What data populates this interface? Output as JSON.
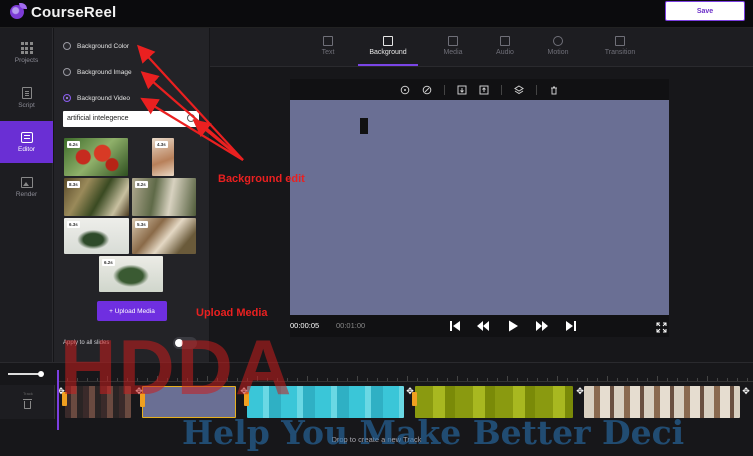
{
  "app": {
    "name": "CourseReel",
    "save_label": "Save"
  },
  "nav": [
    {
      "label": "Projects",
      "icon": "grid-icon"
    },
    {
      "label": "Script",
      "icon": "document-icon"
    },
    {
      "label": "Editor",
      "icon": "editor-icon",
      "active": true
    },
    {
      "label": "Render",
      "icon": "image-icon"
    }
  ],
  "panel": {
    "options": [
      {
        "label": "Background Color",
        "selected": false
      },
      {
        "label": "Background Image",
        "selected": false
      },
      {
        "label": "Background Video",
        "selected": true
      }
    ],
    "search_value": "artificial intelegence",
    "thumbs": [
      "6.2s",
      "4.3s",
      "8.3s",
      "8.2s",
      "6.3s",
      "5.3s",
      "6.2s"
    ],
    "upload_label": "+ Upload Media",
    "apply_label": "Apply to all slides",
    "apply_enabled": false
  },
  "tabs": [
    {
      "label": "Text",
      "icon": "text-icon"
    },
    {
      "label": "Background",
      "icon": "background-icon",
      "active": true
    },
    {
      "label": "Media",
      "icon": "media-icon"
    },
    {
      "label": "Audio",
      "icon": "audio-icon"
    },
    {
      "label": "Motion",
      "icon": "motion-icon"
    },
    {
      "label": "Transition",
      "icon": "transition-icon"
    }
  ],
  "player": {
    "current_time": "00:00:05",
    "total_time": "00:01:00"
  },
  "timeline": {
    "drop_text": "Drop to create a new Track",
    "track_label": "Track"
  },
  "annotations": {
    "background_edit": "Background edit",
    "upload_media": "Upload Media"
  },
  "watermark": {
    "title": "HDDA",
    "subtitle": "Help You Make Better Deci"
  },
  "colors": {
    "accent": "#6f2fe0",
    "canvas": "#6a6f94",
    "annotation": "#ea2020"
  }
}
